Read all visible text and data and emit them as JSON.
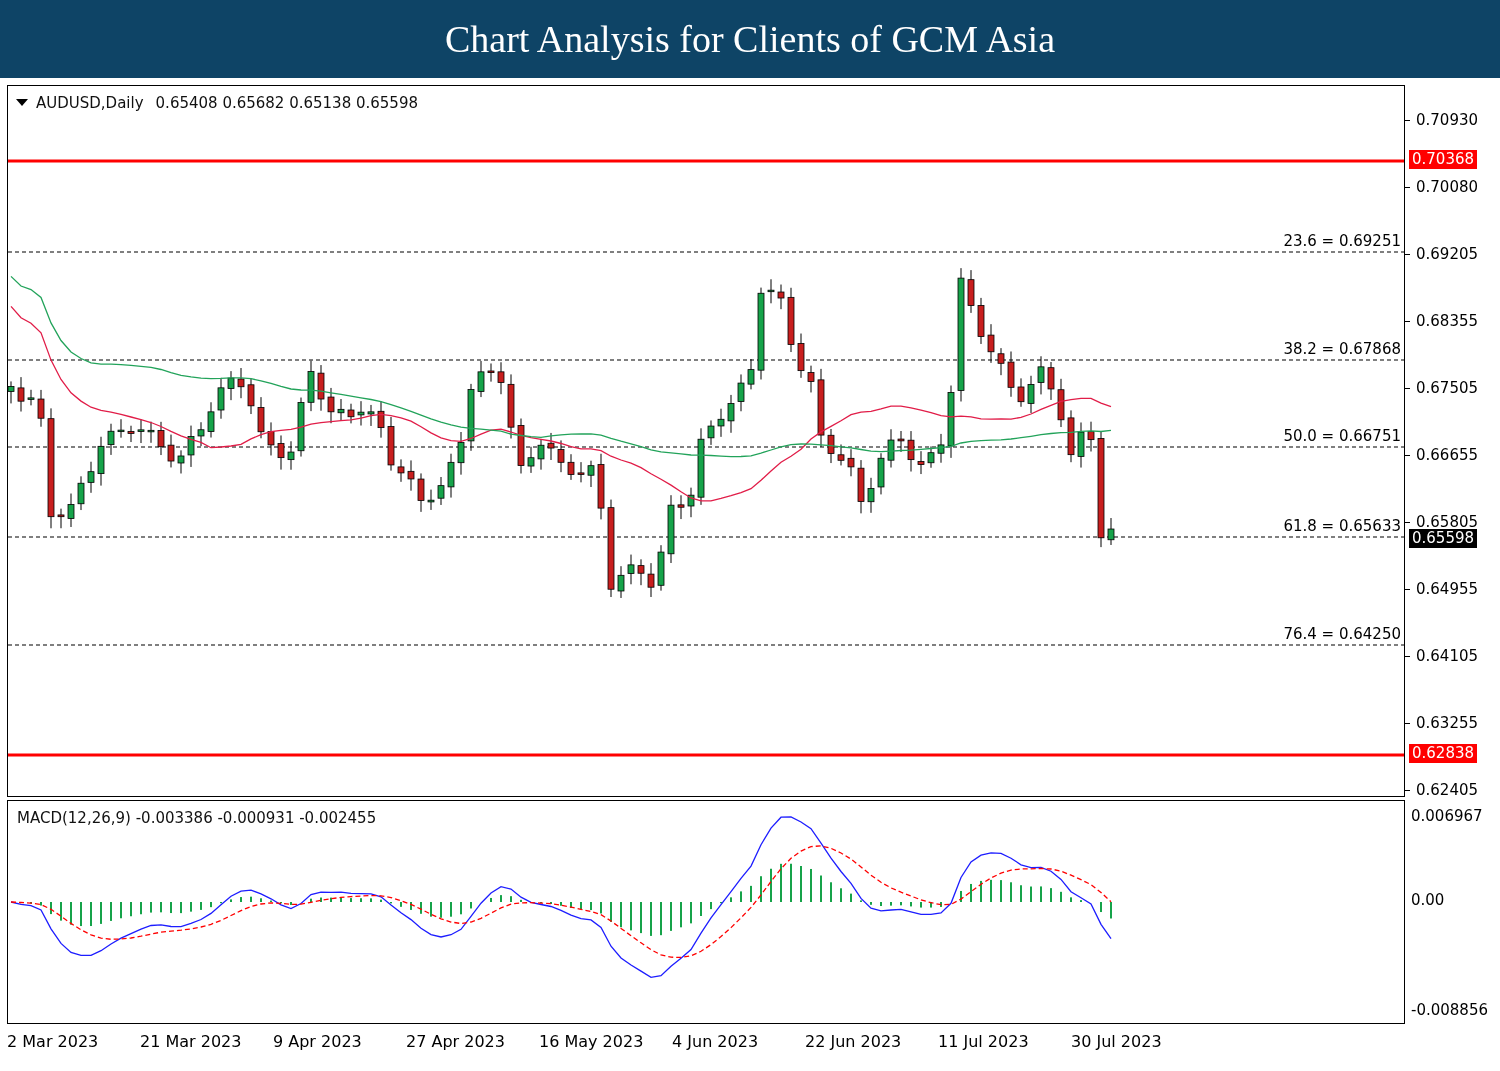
{
  "header": {
    "title": "Chart Analysis for Clients of GCM Asia"
  },
  "price_chart": {
    "symbol": "AUDUSD,Daily",
    "ohlc": "0.65408 0.65682 0.65138 0.65598",
    "current_price": "0.65598",
    "price_axis": [
      "0.70930",
      "0.70080",
      "0.69205",
      "0.68355",
      "0.67505",
      "0.66655",
      "0.65805",
      "0.64955",
      "0.64105",
      "0.63255",
      "0.62405"
    ],
    "levels": [
      {
        "label": "0.70368"
      },
      {
        "label": "0.62838"
      }
    ],
    "fib_levels": [
      {
        "label": "23.6 = 0.69251"
      },
      {
        "label": "38.2 = 0.67868"
      },
      {
        "label": "50.0 = 0.66751"
      },
      {
        "label": "61.8 = 0.65633"
      },
      {
        "label": "76.4 = 0.64250"
      }
    ]
  },
  "macd": {
    "label": "MACD(12,26,9) -0.003386 -0.000931 -0.002455",
    "axis": [
      "0.006967",
      "0.00",
      "-0.008856"
    ]
  },
  "date_axis": [
    "2 Mar 2023",
    "21 Mar 2023",
    "9 Apr 2023",
    "27 Apr 2023",
    "16 May 2023",
    "4 Jun 2023",
    "22 Jun 2023",
    "11 Jul 2023",
    "30 Jul 2023"
  ]
}
